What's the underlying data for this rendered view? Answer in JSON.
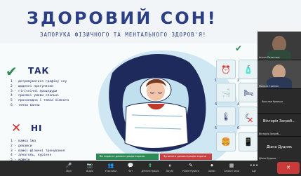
{
  "slide": {
    "title": "ЗДОРОВИЙ СОН!",
    "subtitle": "ЗАПОРУКА ФІЗИЧНОГО ТА МЕНТАЛЬНОГО ЗДОРОВ'Я!",
    "yes": {
      "title": "ТАК",
      "items": [
        "1 - дотримуватися графіку сну",
        "2 - щоденні прогулянки",
        "3 - гігієнічні процедури",
        "4 - приємні умови спальні",
        "5 - прохолодна і темна кімната",
        "6 - тепла ванна"
      ]
    },
    "no": {
      "title": "НІ",
      "items": [
        "1 - важка їжа",
        "2 - девайси",
        "3 - важкі фізичні тренування",
        "4 - алкоголь, куріння",
        "5 - кофеїн"
      ]
    },
    "tile_numbers": [
      "1",
      "2",
      "3",
      "4",
      "5",
      "6"
    ],
    "tile_icons": [
      "clock-icon",
      "bottle-icon",
      "bath-icon",
      "bed-icon",
      "thermometer-icon",
      "sleeper-icon"
    ],
    "colors": {
      "title": "#2c3e86",
      "check": "#2e8b57",
      "cross": "#d32c2c"
    }
  },
  "participants": [
    {
      "name": "Антон Палагнюк",
      "video": true
    },
    {
      "name": "Микола Гринюк",
      "video": true
    },
    {
      "name": "Ярослав Кравчук",
      "video": false
    },
    {
      "name": "Вікторія Загреб...",
      "video": false
    },
    {
      "name": "Діана Дудник",
      "video": false
    }
  ],
  "notifications": {
    "green": "Ви надаєте демонстрацію екрана",
    "red": "Зупинити демонстрацію екрана"
  },
  "toolbar": {
    "items": [
      {
        "icon": "microphone-icon",
        "label": "Звук"
      },
      {
        "icon": "camera-icon",
        "label": "Відео"
      },
      {
        "icon": "people-icon",
        "label": "Учасники"
      },
      {
        "icon": "chat-icon",
        "label": "Чат"
      },
      {
        "icon": "share-icon",
        "label": "Демонстрація"
      },
      {
        "icon": "pause-icon",
        "label": "Пауза"
      },
      {
        "icon": "annotate-icon",
        "label": "Коментувати"
      },
      {
        "icon": "record-icon",
        "label": "Запис"
      },
      {
        "icon": "rooms-icon",
        "label": "Сесійні зали"
      },
      {
        "icon": "more-icon",
        "label": "Ще"
      }
    ],
    "end_label": "✕"
  }
}
